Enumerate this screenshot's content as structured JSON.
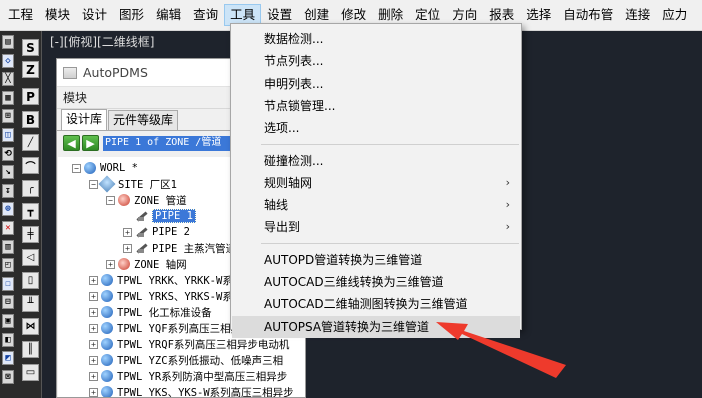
{
  "menubar": {
    "items": [
      "工程",
      "模块",
      "设计",
      "图形",
      "编辑",
      "查询",
      "工具",
      "设置",
      "创建",
      "修改",
      "删除",
      "定位",
      "方向",
      "报表",
      "选择",
      "自动布管",
      "连接",
      "应力"
    ],
    "active_index": 6
  },
  "viewport": {
    "label": "[-][俯视][二维线框]"
  },
  "left_toolbar": {
    "letters": [
      "S",
      "Z",
      "P",
      "B"
    ]
  },
  "panel": {
    "title": "AutoPDMS",
    "module_label": "模块",
    "tabs": [
      "设计库",
      "元件等级库"
    ],
    "active_tab": 0,
    "path": "PIPE 1 of ZONE /管道",
    "tree": [
      {
        "text": "WORL *",
        "level": 0,
        "icon": "globe-icon",
        "exp": "-"
      },
      {
        "text": "SITE 厂区1",
        "level": 1,
        "icon": "site-icon",
        "exp": "-"
      },
      {
        "text": "ZONE 管道",
        "level": 2,
        "icon": "zone-icon",
        "exp": "-"
      },
      {
        "text": "PIPE 1",
        "level": 3,
        "icon": "pipe-icon",
        "exp": "",
        "selected": true
      },
      {
        "text": "PIPE 2",
        "level": 3,
        "icon": "pipe-icon",
        "exp": "+"
      },
      {
        "text": "PIPE 主蒸汽管道",
        "level": 3,
        "icon": "pipe-icon",
        "exp": "+"
      },
      {
        "text": "ZONE 轴网",
        "level": 2,
        "icon": "zone-icon",
        "exp": "+"
      },
      {
        "text": "TPWL YRKK、YRKK-W系列",
        "level": 1,
        "icon": "globe-icon",
        "exp": "+"
      },
      {
        "text": "TPWL YRKS、YRKS-W系列",
        "level": 1,
        "icon": "globe-icon",
        "exp": "+"
      },
      {
        "text": "TPWL 化工标准设备",
        "level": 1,
        "icon": "globe-icon",
        "exp": "+"
      },
      {
        "text": "TPWL YQF系列高压三相异步电动机",
        "level": 1,
        "icon": "globe-icon",
        "exp": "+"
      },
      {
        "text": "TPWL YRQF系列高压三相异步电动机",
        "level": 1,
        "icon": "globe-icon",
        "exp": "+"
      },
      {
        "text": "TPWL YZC系列低振动、低噪声三相",
        "level": 1,
        "icon": "globe-icon",
        "exp": "+"
      },
      {
        "text": "TPWL YR系列防滴中型高压三相异步",
        "level": 1,
        "icon": "globe-icon",
        "exp": "+"
      },
      {
        "text": "TPWL YKS、YKS-W系列高压三相异步",
        "level": 1,
        "icon": "globe-icon",
        "exp": "+"
      }
    ]
  },
  "dropdown": {
    "items": [
      {
        "label": "数据检测...",
        "submenu": false
      },
      {
        "label": "节点列表...",
        "submenu": false
      },
      {
        "label": "申明列表...",
        "submenu": false
      },
      {
        "label": "节点锁管理...",
        "submenu": false
      },
      {
        "label": "选项...",
        "submenu": false
      },
      {
        "separator": true
      },
      {
        "label": "碰撞检测...",
        "submenu": false
      },
      {
        "label": "规则轴网",
        "submenu": true
      },
      {
        "label": "轴线",
        "submenu": true
      },
      {
        "label": "导出到",
        "submenu": true
      },
      {
        "separator": true
      },
      {
        "label": "AUTOPD管道转换为三维管道",
        "submenu": false
      },
      {
        "label": "AUTOCAD三维线转换为三维管道",
        "submenu": false
      },
      {
        "label": "AUTOCAD二维轴测图转换为三维管道",
        "submenu": false
      },
      {
        "label": "AUTOPSA管道转换为三维管道",
        "submenu": false,
        "highlighted": true
      }
    ]
  },
  "colors": {
    "canvas_bg": "#1e232c",
    "selection": "#3b78d8",
    "annotation_arrow": "#ee3a2c"
  }
}
